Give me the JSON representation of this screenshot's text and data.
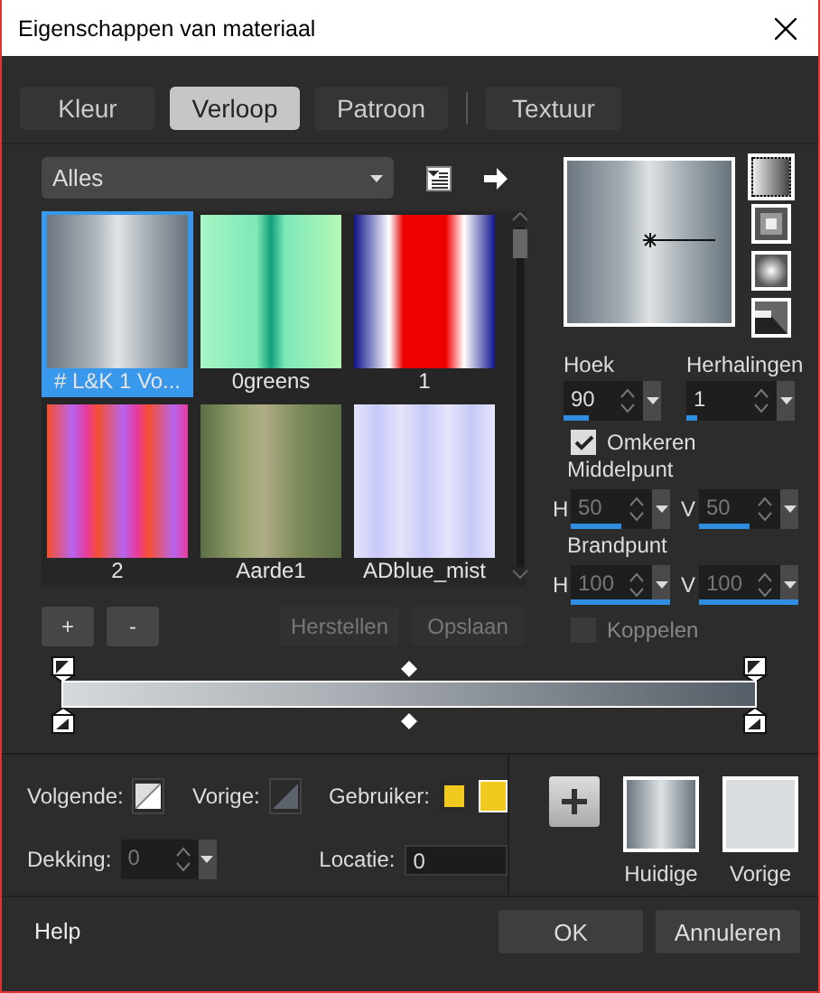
{
  "window": {
    "title": "Eigenschappen van materiaal"
  },
  "tabs": [
    {
      "label": "Kleur",
      "selected": false
    },
    {
      "label": "Verloop",
      "selected": true
    },
    {
      "label": "Patroon",
      "selected": false
    },
    {
      "label": "Textuur",
      "selected": false
    }
  ],
  "library": {
    "category": "Alles",
    "gradients": [
      {
        "name": "# L&K 1 Vo...",
        "selected": true
      },
      {
        "name": "0greens",
        "selected": false
      },
      {
        "name": "1",
        "selected": false
      },
      {
        "name": "2",
        "selected": false
      },
      {
        "name": "Aarde1",
        "selected": false
      },
      {
        "name": "ADblue_mist",
        "selected": false
      }
    ]
  },
  "list_buttons": [
    {
      "label": "+",
      "disabled": false
    },
    {
      "label": "-",
      "disabled": false
    },
    {
      "label": "Herstellen",
      "disabled": true
    },
    {
      "label": "Opslaan",
      "disabled": true
    }
  ],
  "style_buttons": [
    {
      "kind": "linear",
      "selected": true
    },
    {
      "kind": "rectangular",
      "selected": false
    },
    {
      "kind": "radial",
      "selected": false
    },
    {
      "kind": "sunburst",
      "selected": false
    }
  ],
  "angle": {
    "label": "Hoek",
    "value": "90",
    "level": 0.25,
    "disabled": false
  },
  "repeats": {
    "label": "Herhalingen",
    "value": "1",
    "level": 0.1,
    "disabled": false
  },
  "invert": {
    "label": "Omkeren",
    "checked": true,
    "disabled": false
  },
  "center": {
    "label": "Middelpunt",
    "fields": [
      {
        "axis": "H",
        "value": "50",
        "level": 0.5,
        "disabled": true
      },
      {
        "axis": "V",
        "value": "50",
        "level": 0.5,
        "disabled": true
      }
    ]
  },
  "focus": {
    "label": "Brandpunt",
    "fields": [
      {
        "axis": "H",
        "value": "100",
        "level": 1,
        "disabled": true
      },
      {
        "axis": "V",
        "value": "100",
        "level": 1,
        "disabled": true
      }
    ]
  },
  "link": {
    "label": "Koppelen",
    "checked": false,
    "disabled": true
  },
  "stops": {
    "next_label": "Volgende:",
    "previous_label": "Vorige:",
    "custom_label": "Gebruiker:"
  },
  "opacity": {
    "label": "Dekking:",
    "value": "0",
    "disabled": true
  },
  "location": {
    "label": "Locatie:",
    "value": "0"
  },
  "swatches": [
    {
      "label": "Huidige"
    },
    {
      "label": "Vorige"
    }
  ],
  "footer": {
    "help": "Help",
    "buttons": [
      "OK",
      "Annuleren"
    ]
  }
}
